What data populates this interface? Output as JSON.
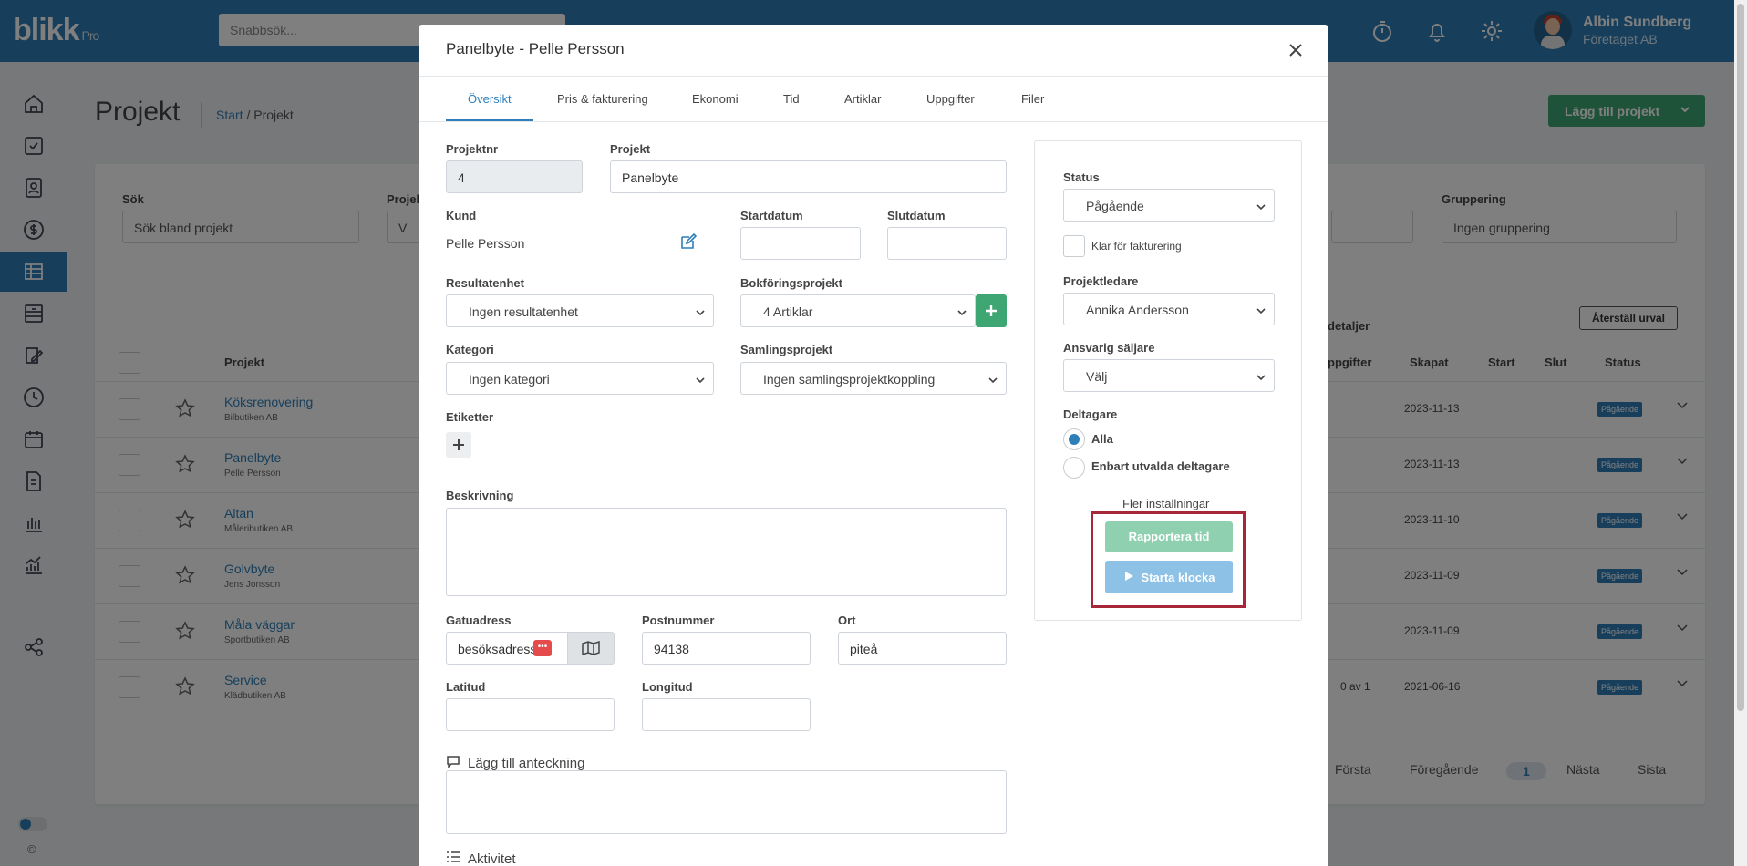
{
  "topbar": {
    "logo": "blikk",
    "logo_suffix": "Pro",
    "search_placeholder": "Snabbsök...",
    "user_name": "Albin Sundberg",
    "user_company": "Företaget AB"
  },
  "page": {
    "title": "Projekt",
    "breadcrumb_home": "Start",
    "breadcrumb_separator": "/",
    "breadcrumb_current": "Projekt",
    "add_button": "Lägg till projekt",
    "filters": {
      "search_label": "Sök",
      "search_placeholder": "Sök bland projekt",
      "project_label": "Projek",
      "project_value": "V",
      "grouping_label": "Gruppering",
      "grouping_value": "Ingen gruppering"
    },
    "reset_button": "Återställ urval",
    "details_label": "detaljer",
    "columns": [
      "Projekt",
      "ppgifter",
      "Skapat",
      "Start",
      "Slut",
      "Status"
    ],
    "rows": [
      {
        "name": "Köksrenovering",
        "client": "Bilbutiken AB",
        "created": "2023-11-13",
        "status": "Pågående"
      },
      {
        "name": "Panelbyte",
        "client": "Pelle Persson",
        "created": "2023-11-13",
        "status": "Pågående"
      },
      {
        "name": "Altan",
        "client": "Måleributiken AB",
        "created": "2023-11-10",
        "status": "Pågående"
      },
      {
        "name": "Golvbyte",
        "client": "Jens Jonsson",
        "created": "2023-11-09",
        "status": "Pågående"
      },
      {
        "name": "Måla väggar",
        "client": "Sportbutiken AB",
        "created": "2023-11-09",
        "status": "Pågående"
      },
      {
        "name": "Service",
        "client": "Klädbutiken AB",
        "created": "2021-06-16",
        "status": "Pågående",
        "tasks": "0 av 1"
      }
    ],
    "pager": {
      "first": "Första",
      "prev": "Föregående",
      "current": "1",
      "next": "Nästa",
      "last": "Sista"
    },
    "copyright": "©"
  },
  "modal": {
    "title": "Panelbyte - Pelle Persson",
    "tabs": [
      "Översikt",
      "Pris & fakturering",
      "Ekonomi",
      "Tid",
      "Artiklar",
      "Uppgifter",
      "Filer"
    ],
    "fields": {
      "projektnr_label": "Projektnr",
      "projektnr_value": "4",
      "projekt_label": "Projekt",
      "projekt_value": "Panelbyte",
      "kund_label": "Kund",
      "kund_value": "Pelle Persson",
      "startdatum_label": "Startdatum",
      "slutdatum_label": "Slutdatum",
      "resultatenhet_label": "Resultatenhet",
      "resultatenhet_value": "Ingen resultatenhet",
      "bokforing_label": "Bokföringsprojekt",
      "bokforing_value": "4 Artiklar",
      "kategori_label": "Kategori",
      "kategori_value": "Ingen kategori",
      "samlings_label": "Samlingsprojekt",
      "samlings_value": "Ingen samlingsprojektkoppling",
      "etiketter_label": "Etiketter",
      "beskrivning_label": "Beskrivning",
      "gatuadress_label": "Gatuadress",
      "gatuadress_value": "besöksadress i",
      "postnummer_label": "Postnummer",
      "postnummer_value": "94138",
      "ort_label": "Ort",
      "ort_value": "piteå",
      "latitud_label": "Latitud",
      "longitud_label": "Longitud",
      "note_heading": "Lägg till anteckning",
      "activity_heading": "Aktivitet"
    },
    "side": {
      "status_label": "Status",
      "status_value": "Pågående",
      "klar_label": "Klar för fakturering",
      "projektledare_label": "Projektledare",
      "projektledare_value": "Annika Andersson",
      "saljare_label": "Ansvarig säljare",
      "saljare_value": "Välj",
      "deltagare_label": "Deltagare",
      "option_all": "Alla",
      "option_selected": "Enbart utvalda deltagare",
      "more_settings": "Fler inställningar",
      "report_time": "Rapportera tid",
      "start_clock": "Starta klocka"
    }
  },
  "colors": {
    "primary": "#2e7fb9",
    "green": "#3ea672",
    "highlight": "#a52738"
  }
}
